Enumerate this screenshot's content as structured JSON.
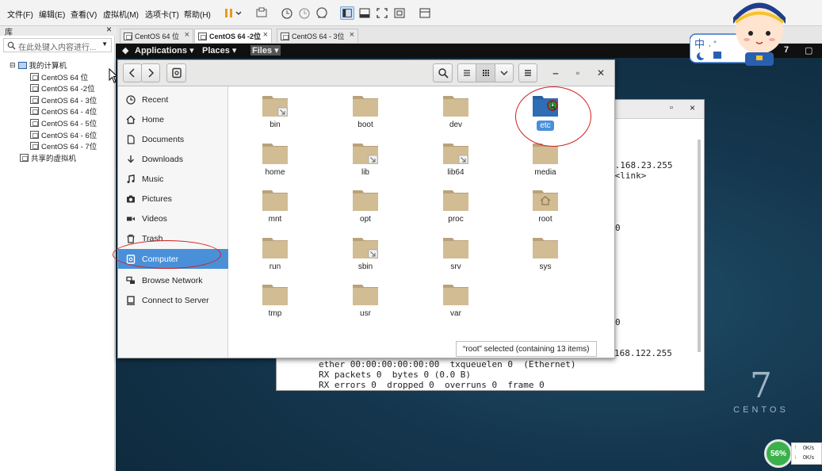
{
  "menubar": {
    "items": [
      "文件(F)",
      "编辑(E)",
      "查看(V)",
      "虚拟机(M)",
      "选项卡(T)",
      "帮助(H)"
    ]
  },
  "library": {
    "title": "库",
    "close": "×",
    "search_placeholder": "在此处键入内容进行...",
    "root": "我的计算机",
    "vms": [
      "CentOS 64 位",
      "CentOS 64 -2位",
      "CentOS 64 - 3位",
      "CentOS 64 - 4位",
      "CentOS 64 - 5位",
      "CentOS 64 - 6位",
      "CentOS 64 - 7位"
    ],
    "shared": "共享的虚拟机"
  },
  "vm_tabs": [
    {
      "label": "CentOS 64 位",
      "active": false
    },
    {
      "label": "CentOS 64 -2位",
      "active": true
    },
    {
      "label": "CentOS 64 - 3位",
      "active": false
    }
  ],
  "gnome": {
    "applications": "Applications",
    "places": "Places",
    "files": "Files",
    "clock_fragment": "7"
  },
  "terminal": {
    "lines": [
      ")",
      "2.168.23.255",
      "0<link>",
      "0",
      "0",
      "168.122.255",
      "ether 00:00:00:00:00:00  txqueuelen 0  (Ethernet)",
      "RX packets 0  bytes 0 (0.0 B)",
      "RX errors 0  dropped 0  overruns 0  frame 0"
    ]
  },
  "nautilus": {
    "places": [
      {
        "label": "Recent",
        "icon": "clock-icon"
      },
      {
        "label": "Home",
        "icon": "home-icon"
      },
      {
        "label": "Documents",
        "icon": "document-icon"
      },
      {
        "label": "Downloads",
        "icon": "download-icon"
      },
      {
        "label": "Music",
        "icon": "music-icon"
      },
      {
        "label": "Pictures",
        "icon": "camera-icon"
      },
      {
        "label": "Videos",
        "icon": "video-icon"
      },
      {
        "label": "Trash",
        "icon": "trash-icon"
      },
      {
        "label": "Computer",
        "icon": "computer-icon",
        "selected": true
      },
      {
        "label": "Browse Network",
        "icon": "network-icon"
      },
      {
        "label": "Connect to Server",
        "icon": "server-icon"
      }
    ],
    "files": [
      {
        "name": "bin",
        "link": true
      },
      {
        "name": "boot"
      },
      {
        "name": "dev"
      },
      {
        "name": "etc",
        "selected": true
      },
      {
        "name": "home"
      },
      {
        "name": "lib",
        "link": true
      },
      {
        "name": "lib64",
        "link": true
      },
      {
        "name": "media"
      },
      {
        "name": "mnt"
      },
      {
        "name": "opt"
      },
      {
        "name": "proc"
      },
      {
        "name": "root",
        "home": true
      },
      {
        "name": "run"
      },
      {
        "name": "sbin",
        "link": true
      },
      {
        "name": "srv"
      },
      {
        "name": "sys"
      },
      {
        "name": "tmp"
      },
      {
        "name": "usr"
      },
      {
        "name": "var"
      }
    ],
    "status": "“root” selected (containing 13 items)"
  },
  "desktop": {
    "logo_number": "7",
    "logo_word": "CENTOS"
  },
  "net_widget": {
    "percent": "56%",
    "up": "0K/s",
    "down": "0K/s"
  },
  "colors": {
    "selection": "#4a90d9",
    "folder": "#d2bc93",
    "annotation": "#d22020"
  }
}
